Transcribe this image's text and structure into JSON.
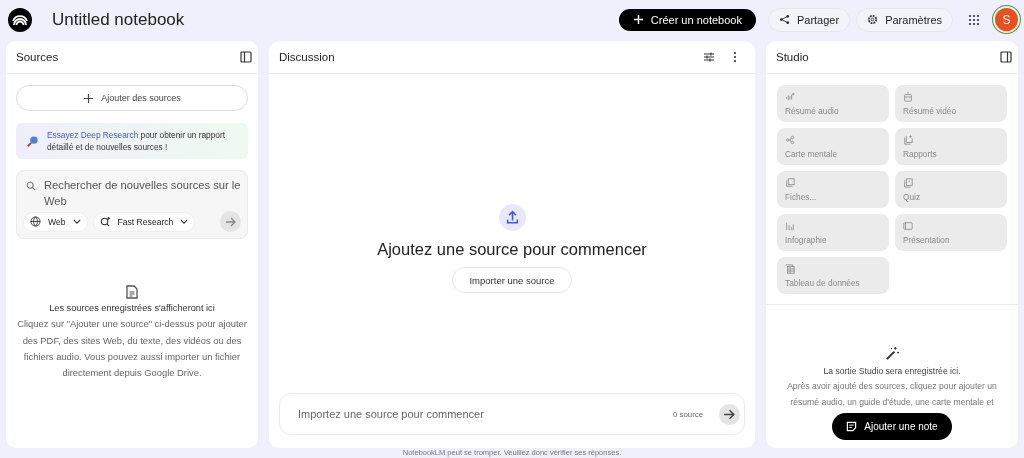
{
  "header": {
    "title": "Untitled notebook",
    "create_button": "Créer un notebook",
    "share_button": "Partager",
    "settings_button": "Paramètres",
    "avatar_letter": "S"
  },
  "sources": {
    "title": "Sources",
    "add_button": "Ajouter des sources",
    "promo_link": "Essayez Deep Research",
    "promo_text": " pour obtenir un rapport détaillé et de nouvelles sources !",
    "search_placeholder": "Rechercher de nouvelles sources sur le Web",
    "web_dropdown": "Web",
    "research_dropdown": "Fast Research",
    "empty_title": "Les sources enregistrées s'afficheront ici",
    "empty_text": "Cliquez sur \"Ajouter une source\" ci-dessus pour ajouter des PDF, des sites Web, du texte, des vidéos ou des fichiers audio. Vous pouvez aussi importer un fichier directement depuis Google Drive."
  },
  "discussion": {
    "title": "Discussion",
    "heading": "Ajoutez une source pour commencer",
    "import_button": "Importer une source",
    "input_placeholder": "Importez une source pour commencer",
    "source_count": "0 source"
  },
  "studio": {
    "title": "Studio",
    "tiles": [
      {
        "kind": "audio",
        "label": "Résumé audio",
        "disabled": true
      },
      {
        "kind": "video",
        "label": "Résumé vidéo",
        "disabled": true
      },
      {
        "kind": "mindmap",
        "label": "Carte mentale",
        "disabled": true
      },
      {
        "kind": "report",
        "label": "Rapports",
        "disabled": true
      },
      {
        "kind": "cards",
        "label": "Fiches...",
        "disabled": true
      },
      {
        "kind": "quiz",
        "label": "Quiz",
        "disabled": true
      },
      {
        "kind": "chart",
        "label": "Infographie",
        "disabled": true
      },
      {
        "kind": "slides",
        "label": "Présentation",
        "disabled": true
      },
      {
        "kind": "table",
        "label": "Tableau de données",
        "disabled": true
      }
    ],
    "empty_title": "La sortie Studio sera enregistrée ici.",
    "empty_text": "Après avoir ajouté des sources, cliquez pour ajouter un résumé audio, un guide d'étude, une carte mentale et",
    "note_button": "Ajouter une note"
  },
  "footer": "NotebookLM peut se tromper. Veuillez donc vérifier ses réponses."
}
